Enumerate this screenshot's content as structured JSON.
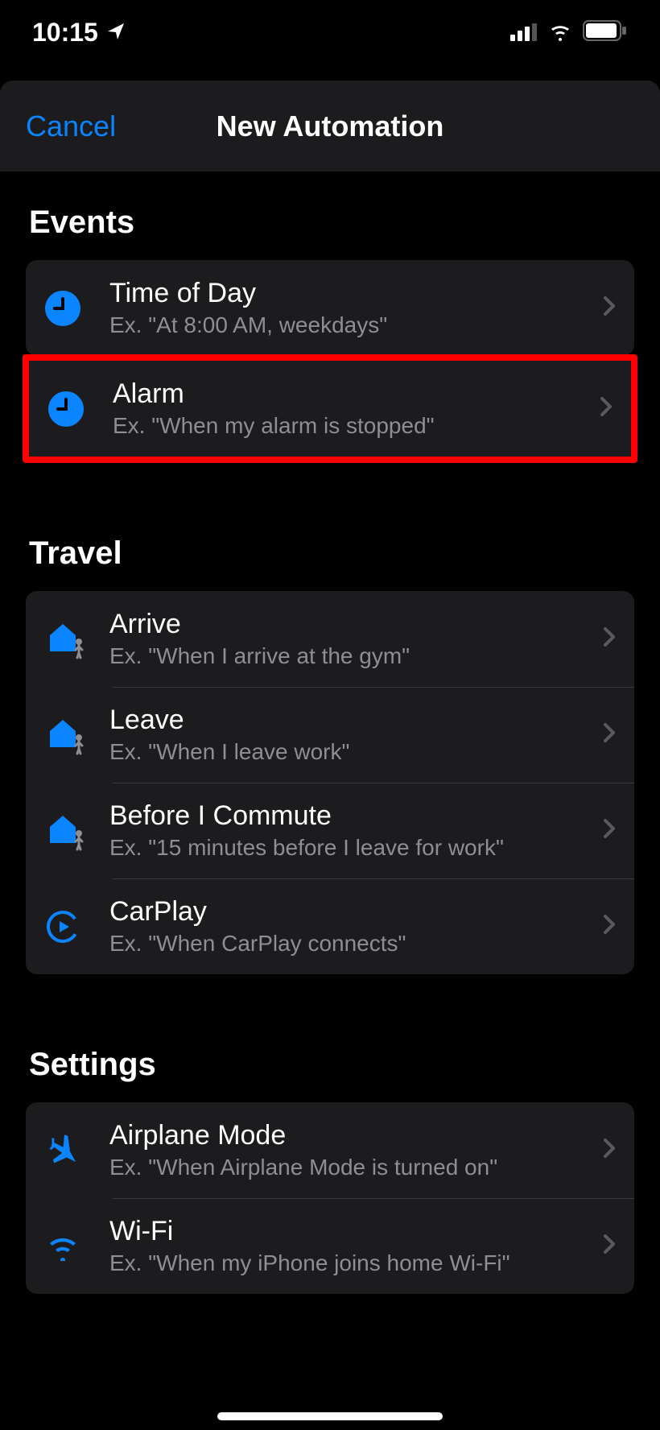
{
  "status": {
    "time": "10:15"
  },
  "sheet": {
    "cancel": "Cancel",
    "title": "New Automation"
  },
  "sections": {
    "events": {
      "header": "Events",
      "items": [
        {
          "title": "Time of Day",
          "subtitle": "Ex. \"At 8:00 AM, weekdays\""
        },
        {
          "title": "Alarm",
          "subtitle": "Ex. \"When my alarm is stopped\""
        }
      ]
    },
    "travel": {
      "header": "Travel",
      "items": [
        {
          "title": "Arrive",
          "subtitle": "Ex. \"When I arrive at the gym\""
        },
        {
          "title": "Leave",
          "subtitle": "Ex. \"When I leave work\""
        },
        {
          "title": "Before I Commute",
          "subtitle": "Ex. \"15 minutes before I leave for work\""
        },
        {
          "title": "CarPlay",
          "subtitle": "Ex. \"When CarPlay connects\""
        }
      ]
    },
    "settings": {
      "header": "Settings",
      "items": [
        {
          "title": "Airplane Mode",
          "subtitle": "Ex. \"When Airplane Mode is turned on\""
        },
        {
          "title": "Wi-Fi",
          "subtitle": "Ex. \"When my iPhone joins home Wi-Fi\""
        }
      ]
    }
  }
}
